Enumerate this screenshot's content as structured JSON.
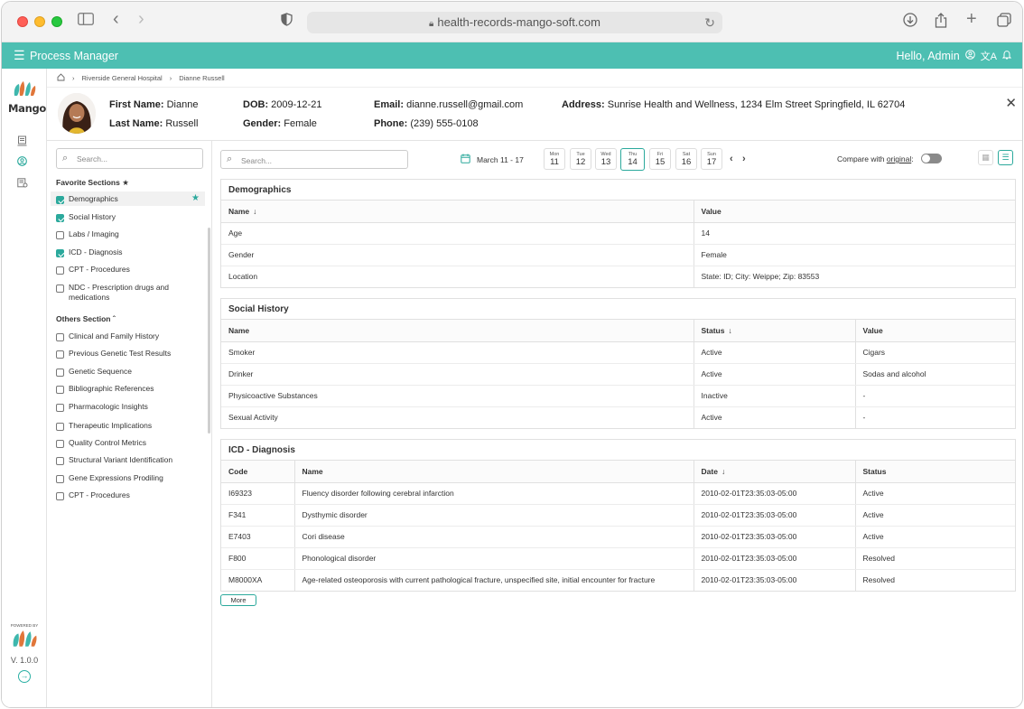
{
  "browser": {
    "url": "health-records-mango-soft.com"
  },
  "app": {
    "title": "Process Manager",
    "greeting": "Hello, Admin",
    "logo_text": "Mango",
    "powered_by": "POWERED BY",
    "version": "V. 1.0.0",
    "accent_color": "#4dbfb2"
  },
  "breadcrumb": [
    "Riverside General Hospital",
    "Dianne Russell"
  ],
  "patient": {
    "first_name_label": "First Name:",
    "first_name": "Dianne",
    "last_name_label": "Last Name:",
    "last_name": "Russell",
    "dob_label": "DOB:",
    "dob": "2009-12-21",
    "gender_label": "Gender:",
    "gender": "Female",
    "email_label": "Email:",
    "email": "dianne.russell@gmail.com",
    "phone_label": "Phone:",
    "phone": "(239) 555-0108",
    "address_label": "Address:",
    "address": "Sunrise Health and Wellness, 1234 Elm Street Springfield, IL 62704"
  },
  "sidebar": {
    "search_placeholder": "Search...",
    "favorites_title": "Favorite Sections",
    "favorites": [
      {
        "label": "Demographics",
        "checked": true
      },
      {
        "label": "Social History",
        "checked": true
      },
      {
        "label": "Labs / Imaging",
        "checked": false
      },
      {
        "label": "ICD - Diagnosis",
        "checked": true
      },
      {
        "label": "CPT - Procedures",
        "checked": false
      },
      {
        "label": "NDC - Prescription drugs and medications",
        "checked": false
      }
    ],
    "others_title": "Others Section",
    "others": [
      "Clinical and Family History",
      "Previous Genetic Test Results",
      "Genetic Sequence",
      "Bibliographic References",
      "Pharmacologic Insights",
      "Therapeutic Implications",
      "Quality Control Metrics",
      "Structural Variant Identification",
      "Gene Expressions Prodiling",
      "CPT - Procedures"
    ]
  },
  "toolbar": {
    "search_placeholder": "Search...",
    "date_range": "March 11 - 17",
    "days": [
      {
        "dow": "Mon",
        "num": "11"
      },
      {
        "dow": "Tue",
        "num": "12"
      },
      {
        "dow": "Wed",
        "num": "13"
      },
      {
        "dow": "Thu",
        "num": "14"
      },
      {
        "dow": "Fri",
        "num": "15"
      },
      {
        "dow": "Sat",
        "num": "16"
      },
      {
        "dow": "Sun",
        "num": "17"
      }
    ],
    "compare_label": "Compare with",
    "compare_link": "original",
    "compare_colon": ":"
  },
  "demographics": {
    "title": "Demographics",
    "headers": [
      "Name",
      "Value"
    ],
    "rows": [
      [
        "Age",
        "14"
      ],
      [
        "Gender",
        "Female"
      ],
      [
        "Location",
        "State: ID; City: Weippe; Zip: 83553"
      ]
    ]
  },
  "social": {
    "title": "Social History",
    "headers": [
      "Name",
      "Status",
      "Value"
    ],
    "rows": [
      [
        "Smoker",
        "Active",
        "Cigars"
      ],
      [
        "Drinker",
        "Active",
        "Sodas and alcohol"
      ],
      [
        "Physicoactive Substances",
        "Inactive",
        "-"
      ],
      [
        "Sexual Activity",
        "Active",
        "-"
      ]
    ]
  },
  "icd": {
    "title": "ICD - Diagnosis",
    "headers": [
      "Code",
      "Name",
      "Date",
      "Status"
    ],
    "rows": [
      [
        "I69323",
        "Fluency disorder following cerebral infarction",
        "2010-02-01T23:35:03-05:00",
        "Active"
      ],
      [
        "F341",
        "Dysthymic disorder",
        "2010-02-01T23:35:03-05:00",
        "Active"
      ],
      [
        "E7403",
        "Cori disease",
        "2010-02-01T23:35:03-05:00",
        "Active"
      ],
      [
        "F800",
        "Phonological disorder",
        "2010-02-01T23:35:03-05:00",
        "Resolved"
      ],
      [
        "M8000XA",
        "Age-related osteoporosis with current pathological fracture, unspecified site, initial encounter for fracture",
        "2010-02-01T23:35:03-05:00",
        "Resolved"
      ]
    ],
    "more_label": "More"
  }
}
